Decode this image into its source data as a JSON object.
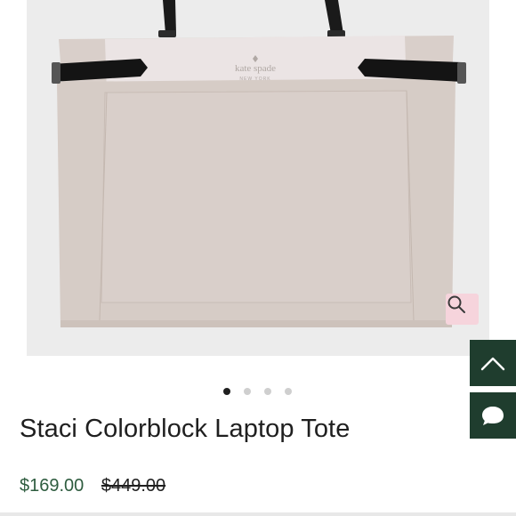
{
  "product": {
    "title": "Staci Colorblock Laptop Tote",
    "price": "$169.00",
    "original_price": "$449.00"
  },
  "image": {
    "brand_logo_text": "kate spade",
    "brand_logo_subtext": "NEW YORK",
    "zoom_icon": "search-icon",
    "carousel_total": 4,
    "carousel_active_index": 0
  },
  "floating": {
    "scroll_top_icon": "chevron-up-icon",
    "chat_icon": "chat-bubble-icon"
  },
  "colors": {
    "accent_green": "#1f3d2e",
    "price_green": "#2e5c3f",
    "zoom_pink": "#f6d4dc",
    "bag_taupe": "#d6ccc6",
    "bag_top_band": "#ebe4e4"
  }
}
